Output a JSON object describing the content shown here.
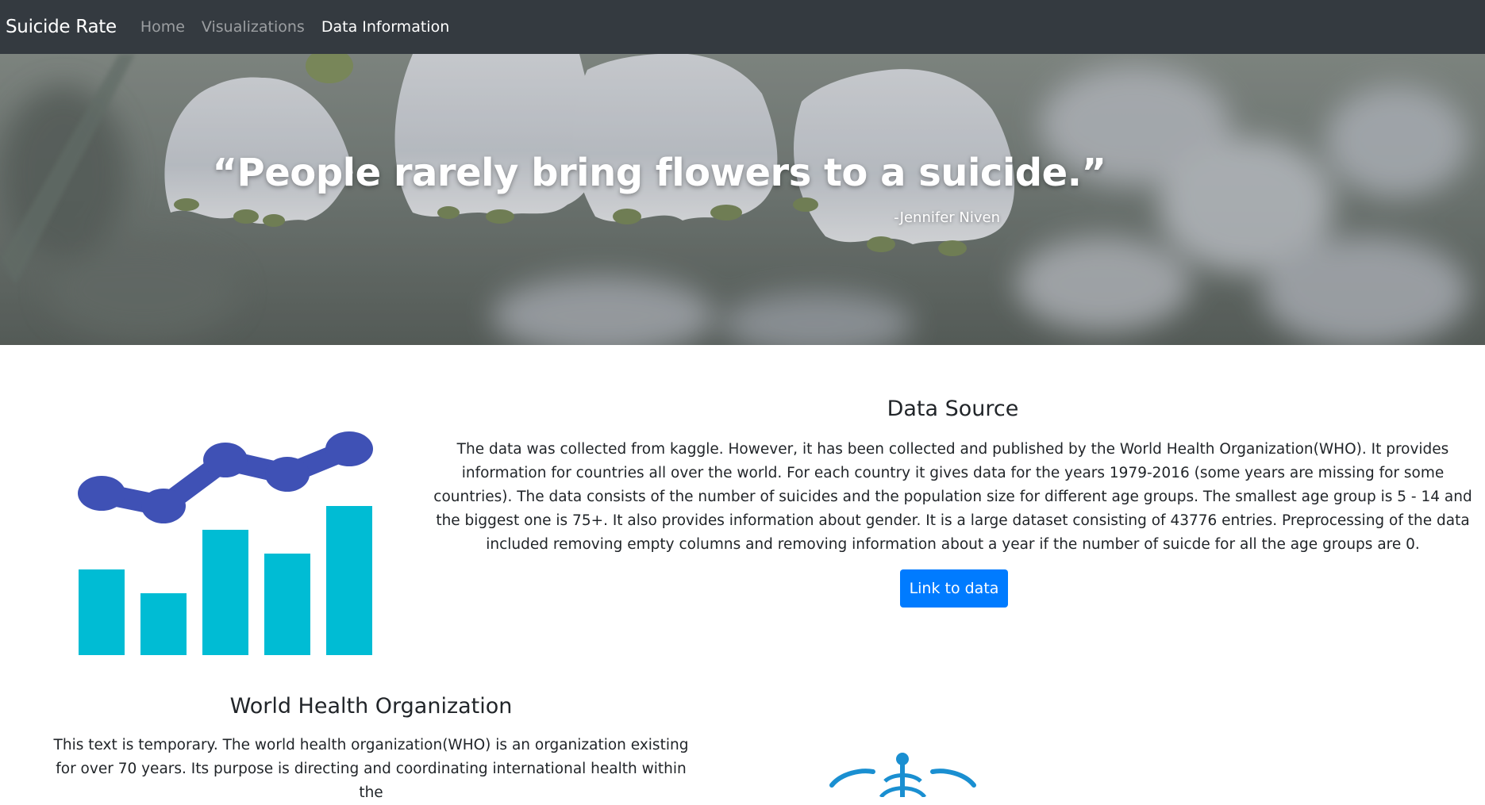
{
  "navbar": {
    "brand": "Suicide Rate",
    "links": [
      {
        "label": "Home",
        "active": false
      },
      {
        "label": "Visualizations",
        "active": false
      },
      {
        "label": "Data Information",
        "active": true
      }
    ]
  },
  "hero": {
    "quote": "“People rarely bring flowers to a suicide.”",
    "author": "-Jennifer Niven"
  },
  "data_source": {
    "title": "Data Source",
    "text": "The data was collected from kaggle. However, it has been collected and published by the World Health Organization(WHO). It provides information for countries all over the world. For each country it gives data for the years 1979-2016 (some years are missing for some countries). The data consists of the number of suicides and the population size for different age groups. The smallest age group is 5 - 14 and the biggest one is 75+. It also provides information about gender. It is a large dataset consisting of 43776 entries. Preprocessing of the data included removing empty columns and removing information about a year if the number of suicde for all the age groups are 0.",
    "button_label": "Link to data"
  },
  "who": {
    "title": "World Health Organization",
    "text": "This text is temporary. The world health organization(WHO) is an organization existing for over 70 years. Its purpose is directing and coordinating international health within the"
  },
  "colors": {
    "navbar_bg": "#343a40",
    "accent_button": "#007bff",
    "illustration_line": "#3f51b5",
    "illustration_bars": "#00bcd4",
    "who_logo": "#1a8fd1"
  }
}
